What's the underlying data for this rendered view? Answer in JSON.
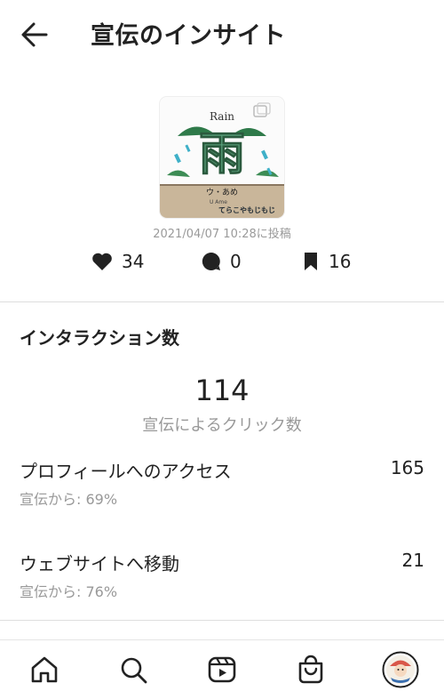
{
  "header": {
    "title": "宣伝のインサイト"
  },
  "post": {
    "thumbnail": {
      "word_en": "Rain",
      "kanji": "雨",
      "reading": "ウ・あめ",
      "romaji": "U   Ame",
      "brand": "てらこやもじもじ"
    },
    "date": "2021/04/07 10:28に投稿",
    "likes": "34",
    "comments": "0",
    "saves": "16"
  },
  "interactions": {
    "title": "インタラクション数",
    "total": "114",
    "total_label": "宣伝によるクリック数",
    "rows": [
      {
        "label": "プロフィールへのアクセス",
        "value": "165",
        "sub": "宣伝から: 69%"
      },
      {
        "label": "ウェブサイトへ移動",
        "value": "21",
        "sub": "宣伝から: 76%"
      }
    ]
  },
  "nav": [
    "home-icon",
    "search-icon",
    "reels-icon",
    "shop-icon",
    "profile-avatar"
  ]
}
